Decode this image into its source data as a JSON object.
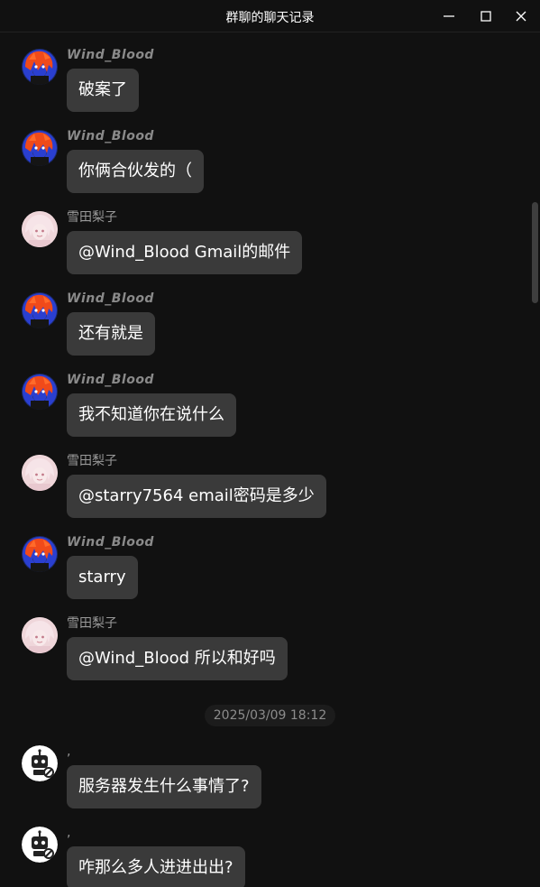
{
  "window": {
    "title": "群聊的聊天记录",
    "minimize_icon": "minimize-icon",
    "maximize_icon": "maximize-icon",
    "close_icon": "close-icon"
  },
  "colors": {
    "background": "#111111",
    "bubble": "#3a3a3a",
    "text": "#ffffff",
    "sender": "#9a9a9a"
  },
  "messages": [
    {
      "sender": "Wind_Blood",
      "avatar": "game-avatar-icon",
      "text": "破案了"
    },
    {
      "sender": "Wind_Blood",
      "avatar": "game-avatar-icon",
      "text": "你俩合伙发的（"
    },
    {
      "sender": "雪田梨子",
      "avatar": "anime-girl-avatar-icon",
      "text": "@Wind_Blood Gmail的邮件"
    },
    {
      "sender": "Wind_Blood",
      "avatar": "game-avatar-icon",
      "text": "还有就是"
    },
    {
      "sender": "Wind_Blood",
      "avatar": "game-avatar-icon",
      "text": "我不知道你在说什么"
    },
    {
      "sender": "雪田梨子",
      "avatar": "anime-girl-avatar-icon",
      "text": "@starry7564 email密码是多少"
    },
    {
      "sender": "Wind_Blood",
      "avatar": "game-avatar-icon",
      "text": "starry"
    },
    {
      "sender": "雪田梨子",
      "avatar": "anime-girl-avatar-icon",
      "text": "@Wind_Blood 所以和好吗"
    },
    {
      "sender": ",",
      "avatar": "robot-avatar-icon",
      "text": "服务器发生什么事情了?"
    },
    {
      "sender": ",",
      "avatar": "robot-avatar-icon",
      "text": "咋那么多人进进出出?"
    }
  ],
  "timestamp": "2025/03/09 18:12"
}
